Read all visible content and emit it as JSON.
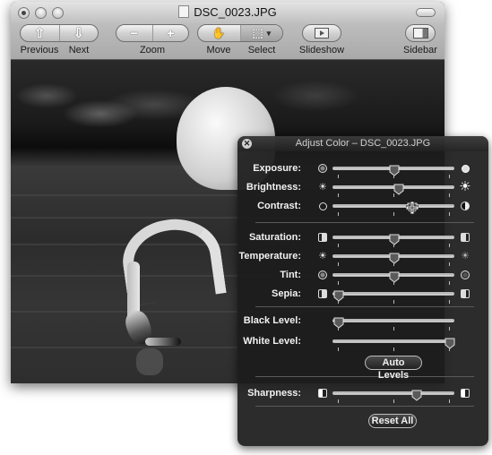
{
  "window": {
    "title": "DSC_0023.JPG",
    "toolbar": {
      "previous_label": "Previous",
      "next_label": "Next",
      "zoom_label": "Zoom",
      "zoom_out_glyph": "−",
      "zoom_in_glyph": "+",
      "move_label": "Move",
      "move_glyph": "✋",
      "select_label": "Select",
      "select_glyph": "⬚",
      "select_arrow_glyph": "▾",
      "slideshow_label": "Slideshow",
      "sidebar_label": "Sidebar",
      "previous_glyph": "⇧",
      "next_glyph": "⇩"
    },
    "image_alt": "Black and white photo of a flamingo feeding in water"
  },
  "adjust_color": {
    "title": "Adjust Color – DSC_0023.JPG",
    "close_glyph": "✕",
    "groups": [
      {
        "sliders": [
          {
            "label": "Exposure:",
            "value": 0.5,
            "left_icon": "exposure-low-icon",
            "right_icon": "exposure-high-icon"
          },
          {
            "label": "Brightness:",
            "value": 0.54,
            "left_icon": "sun-small-icon",
            "right_icon": "sun-large-icon"
          },
          {
            "label": "Contrast:",
            "value": 0.66,
            "left_icon": "contrast-low-icon",
            "right_icon": "contrast-high-icon",
            "cursor": true
          }
        ]
      },
      {
        "sliders": [
          {
            "label": "Saturation:",
            "value": 0.5,
            "left_icon": "saturation-low-icon",
            "right_icon": "saturation-high-icon"
          },
          {
            "label": "Temperature:",
            "value": 0.5,
            "left_icon": "temperature-cool-icon",
            "right_icon": "temperature-warm-icon"
          },
          {
            "label": "Tint:",
            "value": 0.5,
            "left_icon": "tint-left-icon",
            "right_icon": "tint-right-icon"
          },
          {
            "label": "Sepia:",
            "value": 0.0,
            "left_icon": "sepia-low-icon",
            "right_icon": "sepia-high-icon"
          }
        ]
      },
      {
        "sliders": [
          {
            "label": "Black Level:",
            "value": 0.0
          },
          {
            "label": "White Level:",
            "value": 1.0
          }
        ],
        "button": "Auto Levels"
      },
      {
        "sliders": [
          {
            "label": "Sharpness:",
            "value": 0.7,
            "left_icon": "sharpness-low-icon",
            "right_icon": "sharpness-high-icon"
          }
        ]
      }
    ],
    "reset_label": "Reset All"
  }
}
